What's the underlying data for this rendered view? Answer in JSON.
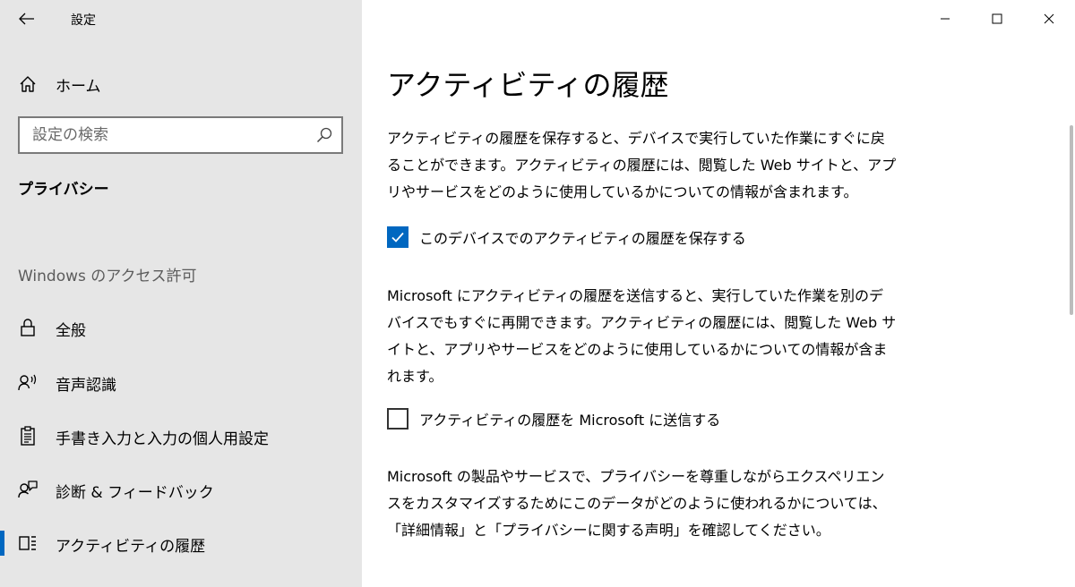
{
  "app": {
    "title": "設定"
  },
  "sidebar": {
    "home_label": "ホーム",
    "search_placeholder": "設定の検索",
    "section_title": "プライバシー",
    "group_header": "Windows のアクセス許可",
    "items": [
      {
        "label": "全般",
        "icon": "lock-icon"
      },
      {
        "label": "音声認識",
        "icon": "speech-icon"
      },
      {
        "label": "手書き入力と入力の個人用設定",
        "icon": "clipboard-icon"
      },
      {
        "label": "診断 & フィードバック",
        "icon": "feedback-icon"
      },
      {
        "label": "アクティビティの履歴",
        "icon": "timeline-icon",
        "selected": true
      }
    ]
  },
  "main": {
    "title": "アクティビティの履歴",
    "para1": "アクティビティの履歴を保存すると、デバイスで実行していた作業にすぐに戻ることができます。アクティビティの履歴には、閲覧した Web サイトと、アプリやサービスをどのように使用しているかについての情報が含まれます。",
    "checkbox1": {
      "label": "このデバイスでのアクティビティの履歴を保存する",
      "checked": true
    },
    "para2": "Microsoft にアクティビティの履歴を送信すると、実行していた作業を別のデバイスでもすぐに再開できます。アクティビティの履歴には、閲覧した Web サイトと、アプリやサービスをどのように使用しているかについての情報が含まれます。",
    "checkbox2": {
      "label": "アクティビティの履歴を Microsoft に送信する",
      "checked": false
    },
    "para3": "Microsoft の製品やサービスで、プライバシーを尊重しながらエクスペリエンスをカスタマイズするためにこのデータがどのように使われるかについては、「詳細情報」と「プライバシーに関する声明」を確認してください。"
  },
  "colors": {
    "accent": "#0067c0",
    "sidebar_bg": "#e6e6e6",
    "main_bg": "#ffffff"
  }
}
